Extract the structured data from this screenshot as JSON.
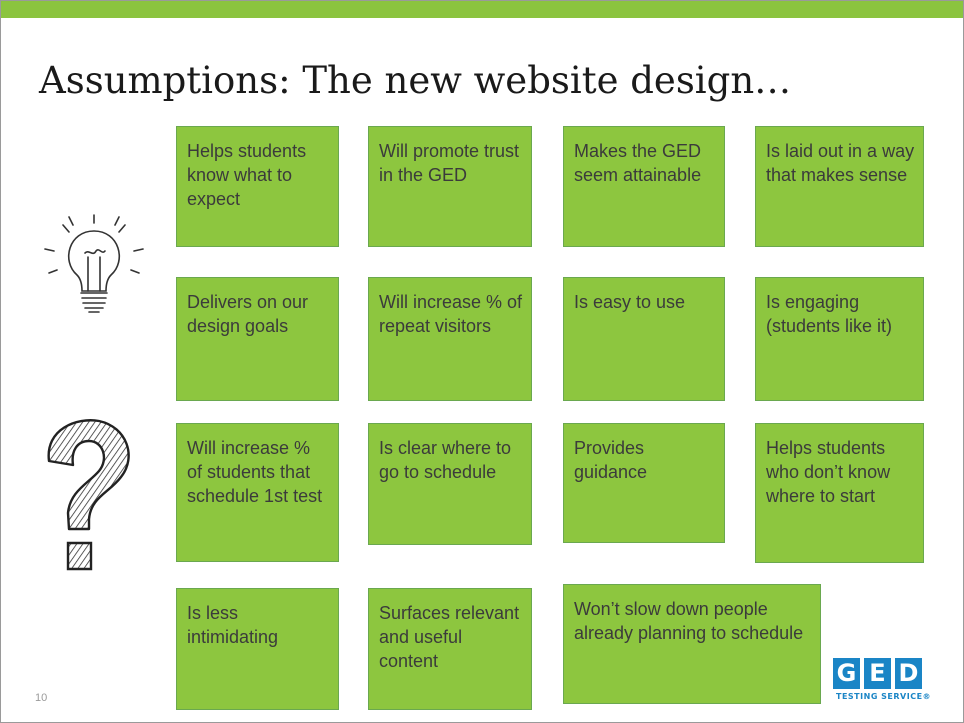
{
  "slide": {
    "title": "Assumptions: The new website design…",
    "page_number": "10"
  },
  "cards": [
    {
      "text": "Helps students know what to expect"
    },
    {
      "text": "Will promote trust in the GED"
    },
    {
      "text": "Makes the GED seem attainable"
    },
    {
      "text": "Is laid out in a way that makes sense"
    },
    {
      "text": "Delivers on our design goals"
    },
    {
      "text": "Will increase % of repeat visitors"
    },
    {
      "text": "Is easy to use"
    },
    {
      "text": "Is engaging (students like it)"
    },
    {
      "text": "Will increase % of students that schedule 1st test"
    },
    {
      "text": "Is clear where to go to schedule"
    },
    {
      "text": "Provides guidance"
    },
    {
      "text": "Helps students who don’t know where to start"
    },
    {
      "text": "Is less intimidating"
    },
    {
      "text": "Surfaces relevant and useful content"
    },
    {
      "text": "Won’t slow down people already planning to schedule"
    }
  ],
  "logo": {
    "letters": [
      "G",
      "E",
      "D"
    ],
    "tagline": "TESTING SERVICE®"
  },
  "colors": {
    "accent_bar": "#8bc43f",
    "card_fill": "#8dc63f",
    "card_text": "#3b3b3b",
    "logo_blue": "#1a85c6"
  },
  "icons": [
    "light-bulb-icon",
    "question-mark-icon"
  ]
}
